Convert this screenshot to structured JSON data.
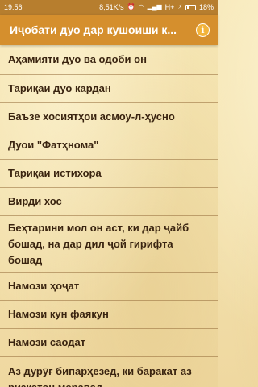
{
  "status_bar": {
    "time": "19:56",
    "net_speed": "8,51K/s",
    "network": "H+",
    "battery": "18%"
  },
  "app_bar": {
    "title": "Иҷобати дуо дар кушоиши к...",
    "info_icon": "info-circle-icon"
  },
  "colors": {
    "status_bar": "#b77e2e",
    "app_bar": "#d58f2d",
    "item_text": "#3a2410"
  },
  "items": [
    "Аҳамияти дуо ва одоби он",
    "Тариқаи дуо кардан",
    "Баъзе хосиятҳои асмоу-л-ҳусно",
    "Дуои \"Фатҳнома\"",
    "Тариқаи истихора",
    "Вирди хос",
    "Беҳтарини мол он аст, ки дар ҷайб бошад, на дар дил ҷой гирифта бошад",
    "Намози ҳоҷат",
    "Намози кун фаякун",
    "Намози саодат",
    "Аз дурӯғ бипарҳезед, ки баракат аз ризқатон меравад"
  ]
}
